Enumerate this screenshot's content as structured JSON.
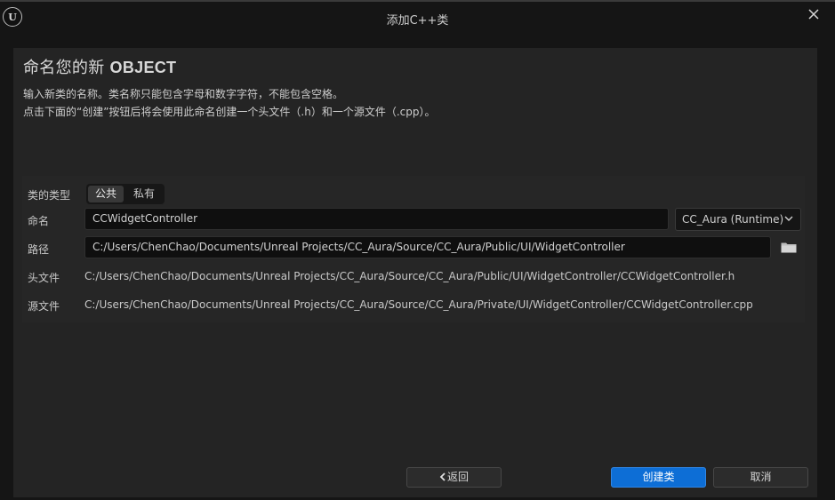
{
  "window": {
    "title": "添加C++类",
    "logo_text": "U"
  },
  "header": {
    "heading_prefix": "命名您的新 ",
    "heading_class": "OBJECT",
    "description_line1": "输入新类的名称。类名称只能包含字母和数字字符，不能包含空格。",
    "description_line2": "点击下面的“创建”按钮后将会使用此命名创建一个头文件（.h）和一个源文件（.cpp）。"
  },
  "form": {
    "class_type_label": "类的类型",
    "class_type_options": {
      "public": "公共",
      "private": "私有"
    },
    "class_type_selected": "public",
    "name_label": "命名",
    "name_value": "CCWidgetController",
    "module_value": "CC_Aura (Runtime)",
    "path_label": "路径",
    "path_value": "C:/Users/ChenChao/Documents/Unreal Projects/CC_Aura/Source/CC_Aura/Public/UI/WidgetController",
    "header_file_label": "头文件",
    "header_file_value": "C:/Users/ChenChao/Documents/Unreal Projects/CC_Aura/Source/CC_Aura/Public/UI/WidgetController/CCWidgetController.h",
    "source_file_label": "源文件",
    "source_file_value": "C:/Users/ChenChao/Documents/Unreal Projects/CC_Aura/Source/CC_Aura/Private/UI/WidgetController/CCWidgetController.cpp"
  },
  "footer": {
    "back_label": "返回",
    "create_label": "创建类",
    "cancel_label": "取消"
  },
  "colors": {
    "primary_button": "#0d6ed6",
    "background": "#151515",
    "panel": "#242424"
  },
  "icons": {
    "close": "close-icon",
    "folder": "folder-icon",
    "chevron": "chevron-down-icon",
    "back_arrow": "chevron-left-icon",
    "logo": "unreal-logo-icon"
  }
}
